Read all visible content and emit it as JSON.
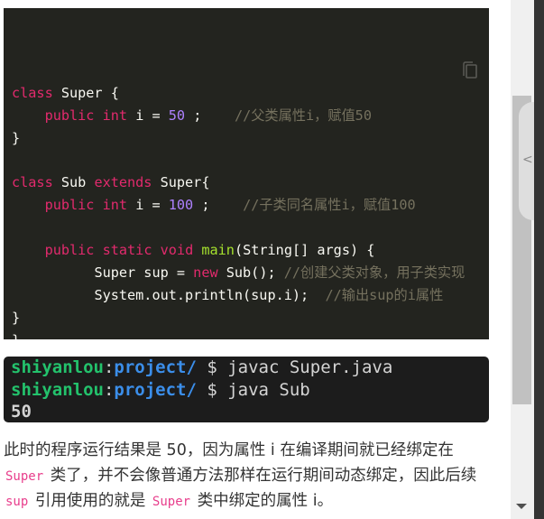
{
  "code_block": {
    "language": "java",
    "copy_icon": "copy-icon",
    "lines": [
      [
        {
          "t": "kw",
          "v": "class"
        },
        {
          "t": "txt",
          "v": " Super {"
        }
      ],
      [
        {
          "t": "txt",
          "v": "    "
        },
        {
          "t": "kw",
          "v": "public"
        },
        {
          "t": "txt",
          "v": " "
        },
        {
          "t": "kw",
          "v": "int"
        },
        {
          "t": "txt",
          "v": " i = "
        },
        {
          "t": "num",
          "v": "50"
        },
        {
          "t": "txt",
          "v": " ;    "
        },
        {
          "t": "cm",
          "v": "//父类属性i，赋值50"
        }
      ],
      [
        {
          "t": "txt",
          "v": "}"
        }
      ],
      [],
      [
        {
          "t": "kw",
          "v": "class"
        },
        {
          "t": "txt",
          "v": " Sub "
        },
        {
          "t": "kw",
          "v": "extends"
        },
        {
          "t": "txt",
          "v": " Super{"
        }
      ],
      [
        {
          "t": "txt",
          "v": "    "
        },
        {
          "t": "kw",
          "v": "public"
        },
        {
          "t": "txt",
          "v": " "
        },
        {
          "t": "kw",
          "v": "int"
        },
        {
          "t": "txt",
          "v": " i = "
        },
        {
          "t": "num",
          "v": "100"
        },
        {
          "t": "txt",
          "v": " ;    "
        },
        {
          "t": "cm",
          "v": "//子类同名属性i，赋值100"
        }
      ],
      [],
      [
        {
          "t": "txt",
          "v": "    "
        },
        {
          "t": "kw",
          "v": "public"
        },
        {
          "t": "txt",
          "v": " "
        },
        {
          "t": "kw",
          "v": "static"
        },
        {
          "t": "txt",
          "v": " "
        },
        {
          "t": "kw",
          "v": "void"
        },
        {
          "t": "txt",
          "v": " "
        },
        {
          "t": "fn",
          "v": "main"
        },
        {
          "t": "txt",
          "v": "(String[] args) {"
        }
      ],
      [
        {
          "t": "txt",
          "v": "          Super sup = "
        },
        {
          "t": "kw",
          "v": "new"
        },
        {
          "t": "txt",
          "v": " Sub(); "
        },
        {
          "t": "cm",
          "v": "//创建父类对象，用子类实现"
        }
      ],
      [
        {
          "t": "txt",
          "v": "          System.out.println(sup.i);  "
        },
        {
          "t": "cm",
          "v": "//输出sup的i属性"
        }
      ],
      [
        {
          "t": "txt",
          "v": "}"
        }
      ],
      [
        {
          "t": "txt",
          "v": "}"
        }
      ]
    ]
  },
  "terminal": {
    "lines": [
      {
        "user": "shiyanlou",
        "colon": ":",
        "path": "project/",
        "cmd": " $ javac Super.java"
      },
      {
        "user": "shiyanlou",
        "colon": ":",
        "path": "project/",
        "cmd": " $ java Sub"
      },
      {
        "output": "50"
      }
    ]
  },
  "paragraph": {
    "segments": [
      {
        "t": "text",
        "v": "此时的程序运行结果是 50，因为属性 i 在编译期间就已经绑定在 "
      },
      {
        "t": "code",
        "v": "Super"
      },
      {
        "t": "text",
        "v": " 类了，并不会像普通方法那样在运行期间动态绑定，因此后续 "
      },
      {
        "t": "code",
        "v": "sup"
      },
      {
        "t": "text",
        "v": " 引用使用的就是 "
      },
      {
        "t": "code",
        "v": "Super"
      },
      {
        "t": "text",
        "v": " 类中绑定的属性 i。"
      }
    ]
  },
  "side_panel": {
    "toggle_icon": "chevron-left-icon",
    "toggle_glyph": "<"
  },
  "scrollbar": {
    "down_icon": "scroll-down-arrow-icon"
  },
  "colors": {
    "code_bg": "#23241f",
    "keyword": "#e22a6d",
    "number": "#ae81ff",
    "function": "#a6e22e",
    "comment": "#75715e",
    "terminal_user": "#23c26c",
    "terminal_path": "#3b8eea",
    "inline_code": "#e83e8c"
  }
}
